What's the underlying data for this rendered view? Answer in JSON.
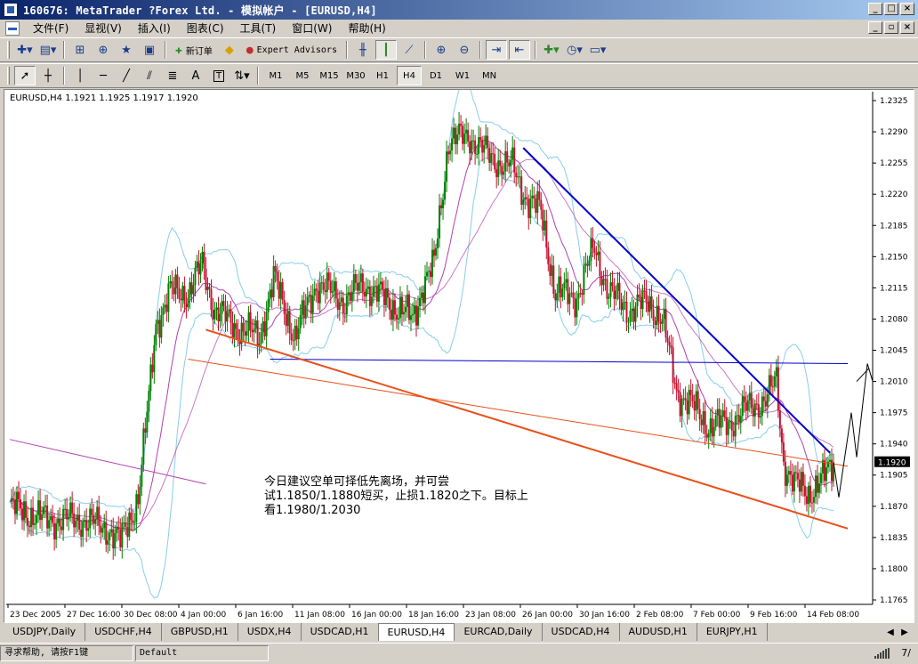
{
  "window": {
    "title": "160676: MetaTrader ?Forex Ltd. - 模拟帐户 - [EURUSD,H4]",
    "buttons": [
      "_",
      "□",
      "×"
    ],
    "mdi_buttons": [
      "_",
      "▫",
      "×"
    ]
  },
  "menu": {
    "items": [
      "文件(F)",
      "显视(V)",
      "插入(I)",
      "图表(C)",
      "工具(T)",
      "窗口(W)",
      "帮助(H)"
    ]
  },
  "toolbar1": {
    "new_order_label": "新订单",
    "expert_advisors_label": "Expert Advisors"
  },
  "toolbar2": {
    "text_tool": "A",
    "label_tool": "T",
    "timeframes": [
      "M1",
      "M5",
      "M15",
      "M30",
      "H1",
      "H4",
      "D1",
      "W1",
      "MN"
    ],
    "active_timeframe": "H4"
  },
  "chart": {
    "header": "EURUSD,H4  1.1921 1.1925 1.1917 1.1920",
    "current_price_label": "1.1920",
    "annotation_lines": [
      "今日建议空单可择低先离场，并可尝",
      "试1.1850/1.1880短买，止损1.1820之下。目标上",
      "看1.1980/1.2030"
    ],
    "colors": {
      "bull_candle": "#008000",
      "bear_candle": "#c8102e",
      "bollinger": "#87ceeb",
      "moving_average": "#b040b0",
      "trend_blue": "#0000cc",
      "trend_orange": "#e8501a",
      "price_label_bg": "#000000"
    }
  },
  "chart_data": {
    "type": "candlestick",
    "symbol": "EURUSD",
    "timeframe": "H4",
    "ohlc_header": {
      "open": 1.1921,
      "high": 1.1925,
      "low": 1.1917,
      "close": 1.192
    },
    "y_ticks": [
      "1.2325",
      "1.2290",
      "1.2255",
      "1.2220",
      "1.2185",
      "1.2150",
      "1.2115",
      "1.2080",
      "1.2045",
      "1.2010",
      "1.1975",
      "1.1940",
      "1.1905",
      "1.1870",
      "1.1835",
      "1.1800",
      "1.1765"
    ],
    "ylim": [
      1.176,
      1.2335
    ],
    "x_ticks": [
      "23 Dec 2005",
      "27 Dec 16:00",
      "30 Dec 08:00",
      "4 Jan 00:00",
      "6 Jan 16:00",
      "11 Jan 08:00",
      "16 Jan 00:00",
      "18 Jan 16:00",
      "23 Jan 08:00",
      "26 Jan 00:00",
      "30 Jan 16:00",
      "2 Feb 08:00",
      "7 Feb 00:00",
      "9 Feb 16:00",
      "14 Feb 08:00"
    ],
    "last_price": 1.192,
    "indicators": [
      "Bollinger Bands",
      "Moving Average"
    ],
    "horizontal_level": 1.203
  },
  "tabs": {
    "items": [
      "USDJPY,Daily",
      "USDCHF,H4",
      "GBPUSD,H1",
      "USDX,H4",
      "USDCAD,H1",
      "EURUSD,H4",
      "EURCAD,Daily",
      "USDCAD,H4",
      "AUDUSD,H1",
      "EURJPY,H1"
    ],
    "active": "EURUSD,H4"
  },
  "status": {
    "help": "寻求帮助, 请按F1键",
    "profile": "Default",
    "traffic": "7/"
  }
}
